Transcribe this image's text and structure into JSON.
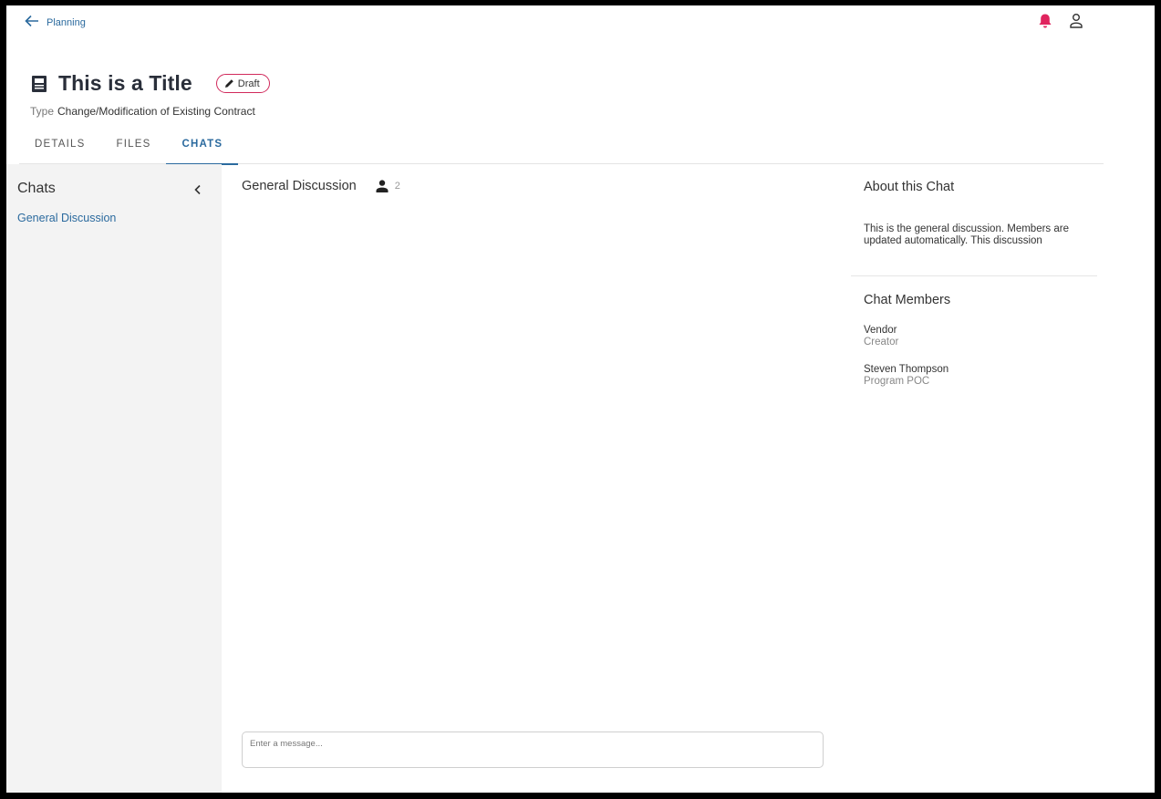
{
  "nav": {
    "back_label": "Planning"
  },
  "header": {
    "title": "This is a Title",
    "status": "Draft",
    "type_label": "Type",
    "type_value": "Change/Modification of Existing Contract"
  },
  "tabs": [
    {
      "label": "DETAILS"
    },
    {
      "label": "FILES"
    },
    {
      "label": "CHATS",
      "active": true
    }
  ],
  "sidebar": {
    "title": "Chats",
    "items": [
      {
        "label": "General Discussion"
      }
    ]
  },
  "chat": {
    "title": "General Discussion",
    "member_count": "2",
    "input_placeholder": "Enter a message..."
  },
  "about": {
    "title": "About this Chat",
    "text": "This is the general discussion. Members are updated automatically. This discussion"
  },
  "members": {
    "title": "Chat Members",
    "list": [
      {
        "name": "Vendor",
        "role": "Creator"
      },
      {
        "name": "Steven Thompson",
        "role": "Program POC"
      }
    ]
  },
  "colors": {
    "accent": "#2b6a9e",
    "notification": "#e0245e",
    "badge_border": "#d12a5c"
  }
}
